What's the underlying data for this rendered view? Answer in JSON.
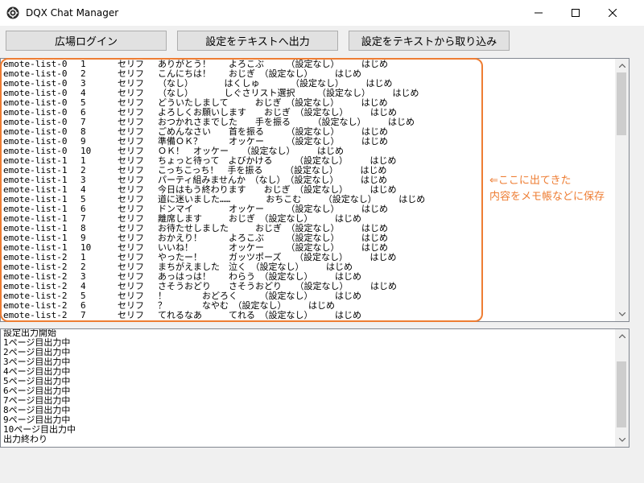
{
  "window": {
    "title": "DQX Chat Manager"
  },
  "toolbar": {
    "login_label": "広場ログイン",
    "export_label": "設定をテキストへ出力",
    "import_label": "設定をテキストから取り込み"
  },
  "emote_rows": [
    {
      "list": "emote-list-0",
      "num": "1",
      "type": "セリフ",
      "text": "ありがとう！　　よろこぶ　　　（設定なし）　　　はじめ"
    },
    {
      "list": "emote-list-0",
      "num": "2",
      "type": "セリフ",
      "text": "こんにちは！　　おじぎ　（設定なし）　　　はじめ"
    },
    {
      "list": "emote-list-0",
      "num": "3",
      "type": "セリフ",
      "text": "（なし）　　　　はくしゅ　　　　（設定なし）　　　はじめ"
    },
    {
      "list": "emote-list-0",
      "num": "4",
      "type": "セリフ",
      "text": "（なし）　　　　しぐさリスト選択　　　（設定なし）　　　はじめ"
    },
    {
      "list": "emote-list-0",
      "num": "5",
      "type": "セリフ",
      "text": "どういたしまして　　　おじぎ　（設定なし）　　　はじめ"
    },
    {
      "list": "emote-list-0",
      "num": "6",
      "type": "セリフ",
      "text": "よろしくお願いします　　おじぎ　（設定なし）　　　はじめ"
    },
    {
      "list": "emote-list-0",
      "num": "7",
      "type": "セリフ",
      "text": "おつかれさまでした　　手を振る　　　（設定なし）　　　はじめ"
    },
    {
      "list": "emote-list-0",
      "num": "8",
      "type": "セリフ",
      "text": "ごめんなさい　　首を振る　　　（設定なし）　　　はじめ"
    },
    {
      "list": "emote-list-0",
      "num": "9",
      "type": "セリフ",
      "text": "準備ＯＫ？　　　オッケー　　　（設定なし）　　　はじめ"
    },
    {
      "list": "emote-list-0",
      "num": "10",
      "type": "セリフ",
      "text": "ＯＫ！　オッケー　　（設定なし）　　　はじめ"
    },
    {
      "list": "emote-list-1",
      "num": "1",
      "type": "セリフ",
      "text": "ちょっと待って　よびかける　　　（設定なし）　　　はじめ"
    },
    {
      "list": "emote-list-1",
      "num": "2",
      "type": "セリフ",
      "text": "こっちこっち！　手を振る　　　（設定なし）　　　はじめ"
    },
    {
      "list": "emote-list-1",
      "num": "3",
      "type": "セリフ",
      "text": "パーティ組みませんか　（なし）　（設定なし）　　　はじめ"
    },
    {
      "list": "emote-list-1",
      "num": "4",
      "type": "セリフ",
      "text": "今日はもう終わります　　おじぎ　（設定なし）　　　はじめ"
    },
    {
      "list": "emote-list-1",
      "num": "5",
      "type": "セリフ",
      "text": "道に迷いました……　　　　おちこむ　　　（設定なし）　　　はじめ"
    },
    {
      "list": "emote-list-1",
      "num": "6",
      "type": "セリフ",
      "text": "ドンマイ　　　　オッケー　　　（設定なし）　　　はじめ"
    },
    {
      "list": "emote-list-1",
      "num": "7",
      "type": "セリフ",
      "text": "離席します　　　おじぎ　（設定なし）　　　はじめ"
    },
    {
      "list": "emote-list-1",
      "num": "8",
      "type": "セリフ",
      "text": "お待たせしました　　　おじぎ　（設定なし）　　　はじめ"
    },
    {
      "list": "emote-list-1",
      "num": "9",
      "type": "セリフ",
      "text": "おかえり！　　　よろこぶ　　　（設定なし）　　　はじめ"
    },
    {
      "list": "emote-list-1",
      "num": "10",
      "type": "セリフ",
      "text": "いいね！　　　　オッケー　　　（設定なし）　　　はじめ"
    },
    {
      "list": "emote-list-2",
      "num": "1",
      "type": "セリフ",
      "text": "やったー！　　　ガッツポーズ　　（設定なし）　　　はじめ"
    },
    {
      "list": "emote-list-2",
      "num": "2",
      "type": "セリフ",
      "text": "まちがえました　泣く　（設定なし）　　　はじめ"
    },
    {
      "list": "emote-list-2",
      "num": "3",
      "type": "セリフ",
      "text": "あっはっは！　　わらう　（設定なし）　　　はじめ"
    },
    {
      "list": "emote-list-2",
      "num": "4",
      "type": "セリフ",
      "text": "さそうおどり　　さそうおどり　　（設定なし）　　　はじめ"
    },
    {
      "list": "emote-list-2",
      "num": "5",
      "type": "セリフ",
      "text": "！　　　　おどろく　　　（設定なし）　　　はじめ"
    },
    {
      "list": "emote-list-2",
      "num": "6",
      "type": "セリフ",
      "text": "？　　　　なやむ　（設定なし）　　　はじめ"
    },
    {
      "list": "emote-list-2",
      "num": "7",
      "type": "セリフ",
      "text": "てれるなあ　　　てれる　（設定なし）　　　はじめ"
    }
  ],
  "log": {
    "lines": [
      "設定出力開始",
      "1ページ目出力中",
      "2ページ目出力中",
      "3ページ目出力中",
      "4ページ目出力中",
      "5ページ目出力中",
      "6ページ目出力中",
      "7ページ目出力中",
      "8ページ目出力中",
      "9ページ目出力中",
      "10ページ目出力中",
      "出力終わり"
    ]
  },
  "annotation": {
    "line1": "⇐ここに出てきた",
    "line2": "内容をメモ帳などに保存"
  },
  "colors": {
    "accent": "#ee7d33"
  },
  "icons": {
    "app": "app-gear-icon",
    "minimize": "minimize-icon",
    "maximize": "maximize-icon",
    "close": "close-icon"
  }
}
